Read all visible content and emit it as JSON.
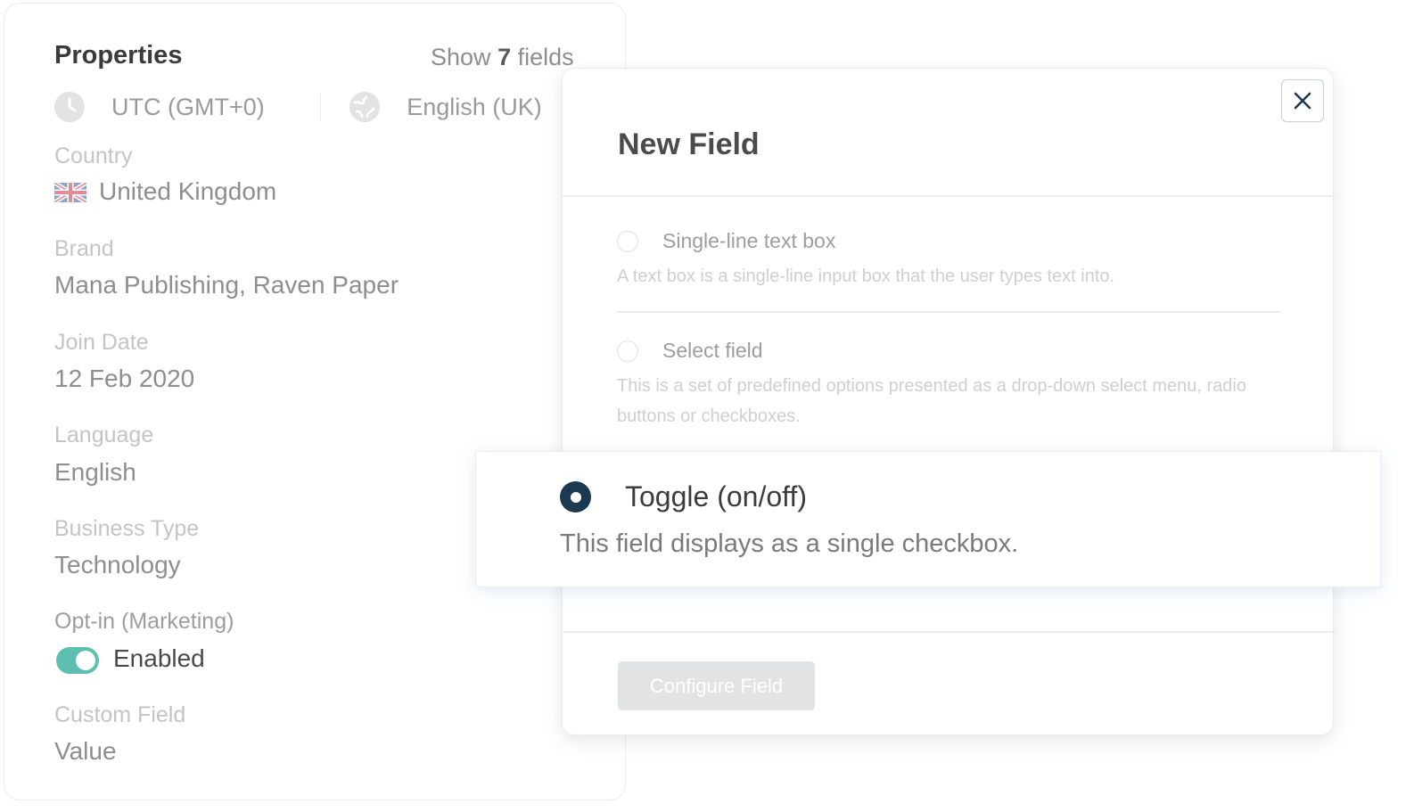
{
  "properties": {
    "title": "Properties",
    "show_prefix": "Show",
    "show_count": "7",
    "show_suffix": "fields",
    "timezone": "UTC (GMT+0)",
    "locale": "English (UK)",
    "fields": [
      {
        "label": "Country",
        "value": "United Kingdom"
      },
      {
        "label": "Brand",
        "value": "Mana Publishing, Raven Paper"
      },
      {
        "label": "Join Date",
        "value": "12 Feb 2020"
      },
      {
        "label": "Language",
        "value": "English"
      },
      {
        "label": "Business Type",
        "value": "Technology"
      },
      {
        "label": "Opt-in (Marketing)",
        "value": "Enabled"
      },
      {
        "label": "Custom Field",
        "value": "Value"
      }
    ],
    "toggle_color": "#5dbfb0"
  },
  "modal": {
    "title": "New Field",
    "options": [
      {
        "title": "Single-line text box",
        "description": "A text box is a single-line input box that the user types text into.",
        "selected": false
      },
      {
        "title": "Select field",
        "description": "This is a set of predefined options presented as a drop-down select menu, radio buttons or checkboxes.",
        "selected": false
      },
      {
        "title": "Toggle (on/off)",
        "description": "This field displays as a single checkbox.",
        "selected": true
      }
    ],
    "configure_label": "Configure Field",
    "accent_color": "#1b3a52"
  }
}
